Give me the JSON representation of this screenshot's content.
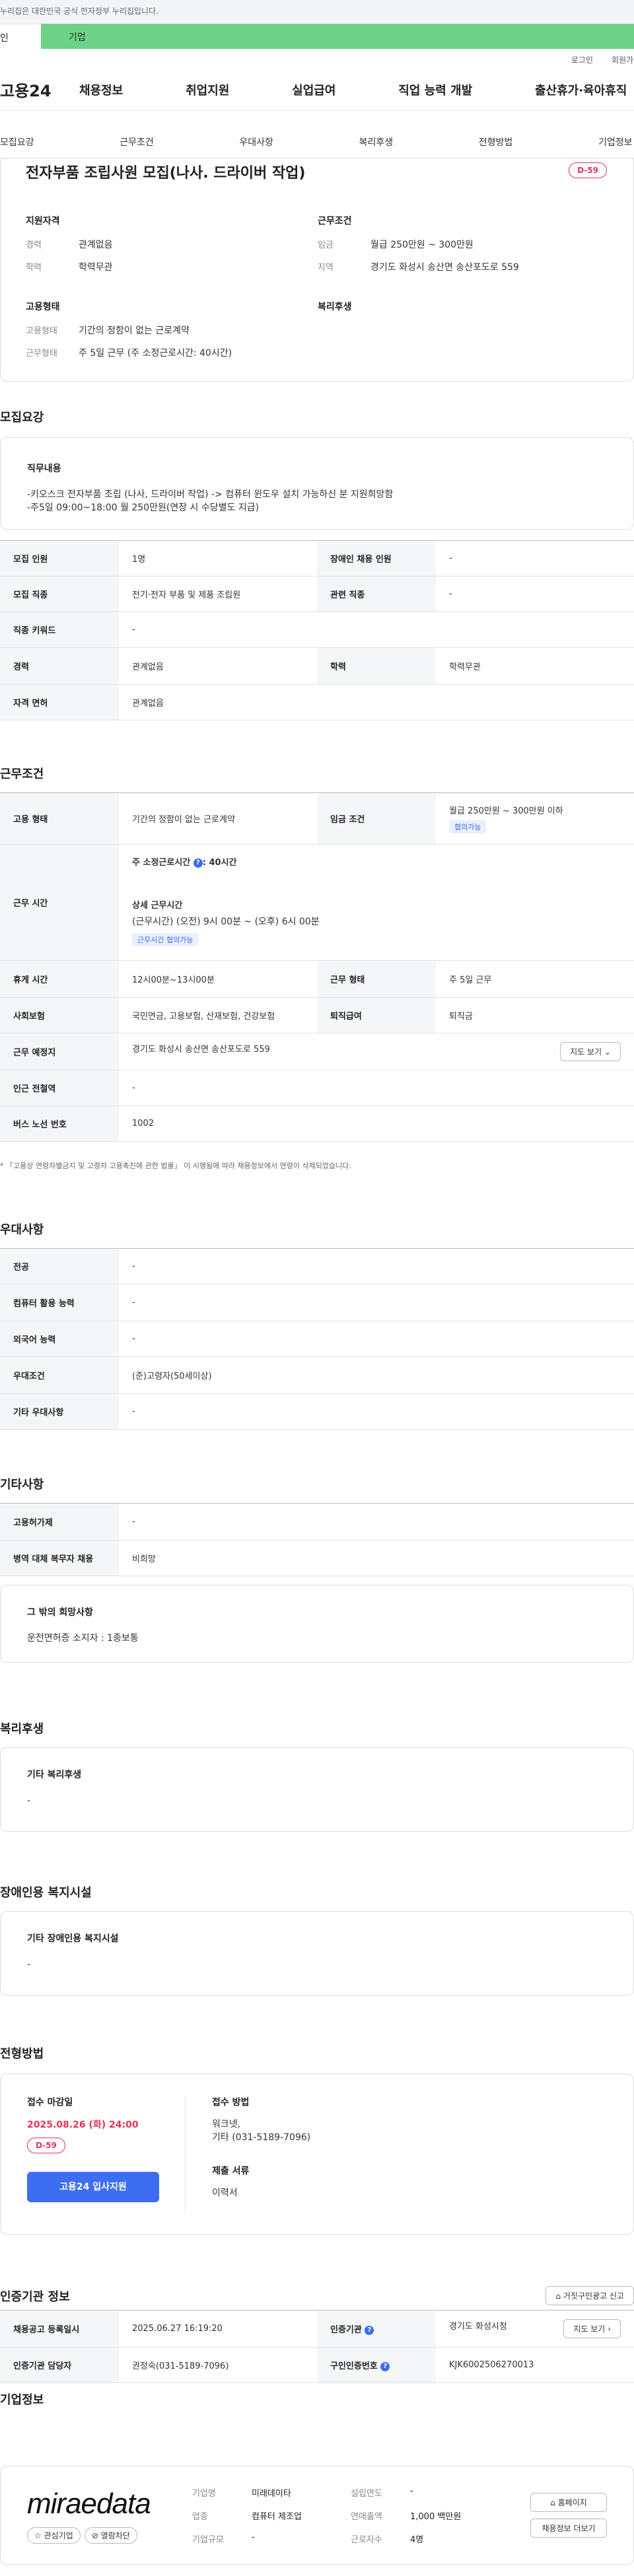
{
  "header": {
    "gov_notice": "누리집은 대한민국 공식 전자정부 누리집입니다.",
    "usertype_personal": "인",
    "usertype_company": "기업",
    "util_login": "로그인",
    "util_join": "회원가입",
    "logo": "고용24",
    "gnb": [
      "채용정보",
      "취업지원",
      "실업급여",
      "직업 능력 개발",
      "출산휴가·육아휴직"
    ],
    "tabs": [
      "모집요강",
      "근무조건",
      "우대사항",
      "복리후생",
      "전형방법",
      "기업정보"
    ]
  },
  "summary": {
    "title": "전자부품 조립사원 모집(나사. 드라이버 작업)",
    "dday": "D-59",
    "qual_title": "지원자격",
    "qual": [
      {
        "k": "경력",
        "v": "관계없음"
      },
      {
        "k": "학력",
        "v": "학력무관"
      }
    ],
    "work_title": "근무조건",
    "work": [
      {
        "k": "임금",
        "v": "월급 250만원 ~ 300만원"
      },
      {
        "k": "지역",
        "v": "경기도 화성시 송산면 송산포도로 559"
      }
    ],
    "emp_title": "고용형태",
    "emp": [
      {
        "k": "고용형태",
        "v": "기간의 정함이 없는 근로계약"
      },
      {
        "k": "근무형태",
        "v": "주 5일 근무 (주 소정근로시간: 40시간)"
      }
    ],
    "welfare_title": "복리후생"
  },
  "recruit": {
    "section": "모집요강",
    "duty_title": "직무내용",
    "duty_lines": [
      "-키오스크 전자부품 조립 (나사, 드라이버 작업) -> 컴퓨터 윈도우 설치 가능하신 분 지원희망함",
      "-주5일 09:00~18:00 월 250만원(연장 시 수당별도 지급)"
    ],
    "rows": [
      [
        {
          "k": "모집 인원",
          "v": "1명"
        },
        {
          "k": "장애인 채용 인원",
          "v": "-"
        }
      ],
      [
        {
          "k": "모집 직종",
          "v": "전기·전자 부품 및 제품 조립원"
        },
        {
          "k": "관련 직종",
          "v": "-"
        }
      ],
      [
        {
          "k": "직종 키워드",
          "v": "-"
        }
      ],
      [
        {
          "k": "경력",
          "v": "관계없음"
        },
        {
          "k": "학력",
          "v": "학력무관"
        }
      ],
      [
        {
          "k": "자격 면허",
          "v": "관계없음"
        }
      ]
    ]
  },
  "work": {
    "section": "근무조건",
    "emp_type_k": "고용 형태",
    "emp_type_v": "기간의 정함이 없는 근로계약",
    "wage_k": "임금 조건",
    "wage_v": "월급 250만원 ~ 300만원 이하",
    "wage_chip": "협의가능",
    "hours_k": "근무 시간",
    "hours_std": "주 소정근로시간",
    "hours_std_v": ": 40시간",
    "hours_detail_title": "상세 근무시간",
    "hours_detail": "(근무시간) (오전) 9시 00분 ~ (오후) 6시 00분",
    "hours_chip": "근무시간 협의가능",
    "break_k": "휴게 시간",
    "break_v": "12시00분~13시00분",
    "shift_k": "근무 형태",
    "shift_v": "주 5일 근무",
    "ins_k": "사회보험",
    "ins_v": "국민연금, 고용보험, 산재보험, 건강보험",
    "sev_k": "퇴직급여",
    "sev_v": "퇴직금",
    "loc_k": "근무 예정지",
    "loc_v": "경기도 화성시 송산면 송산포도로 559",
    "map_btn": "지도 보기",
    "subway_k": "인근 전철역",
    "subway_v": "-",
    "bus_k": "버스 노선 번호",
    "bus_v": "1002",
    "note": "* 「고용상 연령차별금지 및 고령자 고용촉진에 관한 법률」 이 시행됨에 따라 채용정보에서 연령이 삭제되었습니다."
  },
  "pref": {
    "section": "우대사항",
    "rows": [
      {
        "k": "전공",
        "v": "-"
      },
      {
        "k": "컴퓨터 활용 능력",
        "v": "-"
      },
      {
        "k": "외국어 능력",
        "v": "-"
      },
      {
        "k": "우대조건",
        "v": "(준)고령자(50세이상)"
      },
      {
        "k": "기타 우대사항",
        "v": "-"
      }
    ]
  },
  "etc": {
    "section": "기타사항",
    "rows": [
      {
        "k": "고용허가제",
        "v": "-"
      },
      {
        "k": "병역 대체 복무자 채용",
        "v": "비희망"
      }
    ],
    "wish_title": "그 밖의 희망사항",
    "wish": "운전면허증 소지자 : 1종보통"
  },
  "welfare": {
    "section": "복리후생",
    "title": "기타 복리후생",
    "value": "-"
  },
  "facility": {
    "section": "장애인용 복지시설",
    "title": "기타 장애인용 복지시설",
    "value": "-"
  },
  "process": {
    "section": "전형방법",
    "deadline_title": "접수 마감일",
    "deadline": "2025.08.26 (화) 24:00",
    "dday": "D-59",
    "apply_btn": "고용24 입사지원",
    "method_title": "접수 방법",
    "method_lines": [
      "워크넷,",
      "기타 (031-5189-7096)"
    ],
    "docs_title": "제출 서류",
    "docs": "이력서"
  },
  "cert": {
    "section": "인증기관 정보",
    "report_btn": "거짓구인광고 신고",
    "reg_k": "채용공고 등록일시",
    "reg_v": "2025.06.27 16:19:20",
    "org_k": "인증기관",
    "org_v": "경기도 화성시청",
    "map_btn": "지도 보기",
    "mgr_k": "인증기관 담당자",
    "mgr_v": "권정숙(031-5189-7096)",
    "num_k": "구인인증번호",
    "num_v": "KJK6002506270013"
  },
  "company": {
    "section": "기업정보",
    "logo_text": "miraedata",
    "fav_btn": "관심기업",
    "block_btn": "열람차단",
    "info": [
      [
        {
          "k": "기업명",
          "v": "미래데이타"
        },
        {
          "k": "설립연도",
          "v": "-"
        }
      ],
      [
        {
          "k": "업종",
          "v": "컴퓨터 제조업"
        },
        {
          "k": "연매출액",
          "v": "1,000 백만원"
        }
      ],
      [
        {
          "k": "기업규모",
          "v": "-"
        },
        {
          "k": "근로자수",
          "v": "4명"
        }
      ]
    ],
    "home_btn": "홈페이지",
    "jobs_btn": "채용정보 더보기"
  },
  "colors": {
    "company_tab": "#6ed188",
    "accent_blue": "#3d6df0",
    "dday_red": "#e3335d"
  }
}
